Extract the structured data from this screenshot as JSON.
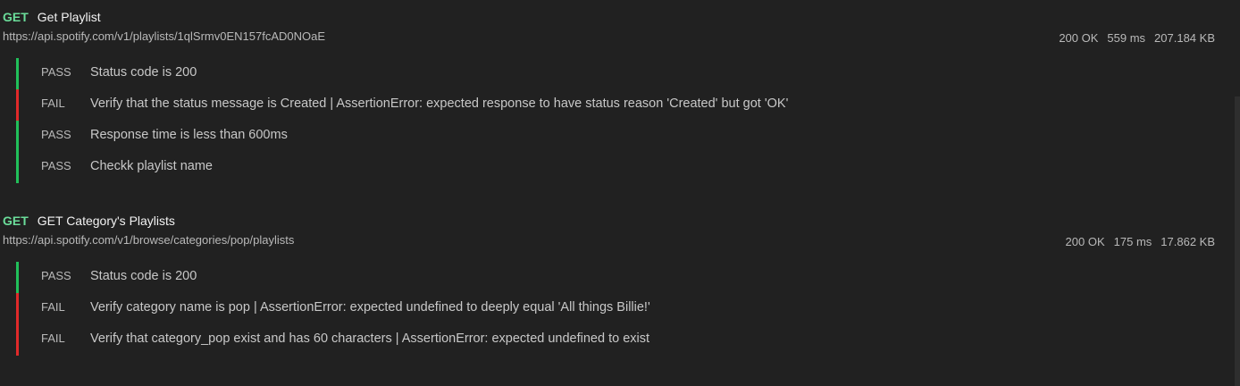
{
  "requests": [
    {
      "method": "GET",
      "name": "Get Playlist",
      "url": "https://api.spotify.com/v1/playlists/1qlSrmv0EN157fcAD0NOaE",
      "status": "200 OK",
      "time": "559 ms",
      "size": "207.184 KB",
      "tests": [
        {
          "result": "PASS",
          "text": "Status code is 200"
        },
        {
          "result": "FAIL",
          "text": "Verify that the status message is Created | AssertionError: expected response to have status reason 'Created' but got 'OK'"
        },
        {
          "result": "PASS",
          "text": "Response time is less than 600ms"
        },
        {
          "result": "PASS",
          "text": "Checkk playlist name"
        }
      ]
    },
    {
      "method": "GET",
      "name": "GET Category's Playlists",
      "url": "https://api.spotify.com/v1/browse/categories/pop/playlists",
      "status": "200 OK",
      "time": "175 ms",
      "size": "17.862 KB",
      "tests": [
        {
          "result": "PASS",
          "text": "Status code is 200"
        },
        {
          "result": "FAIL",
          "text": "Verify category name is pop | AssertionError: expected undefined to deeply equal 'All things Billie!'"
        },
        {
          "result": "FAIL",
          "text": "Verify that category_pop exist and has 60 characters | AssertionError: expected undefined to exist"
        }
      ]
    }
  ],
  "colors": {
    "background": "#212121",
    "method": "#6bdd9a",
    "pass": "#21c05a",
    "fail": "#e02a2a"
  }
}
